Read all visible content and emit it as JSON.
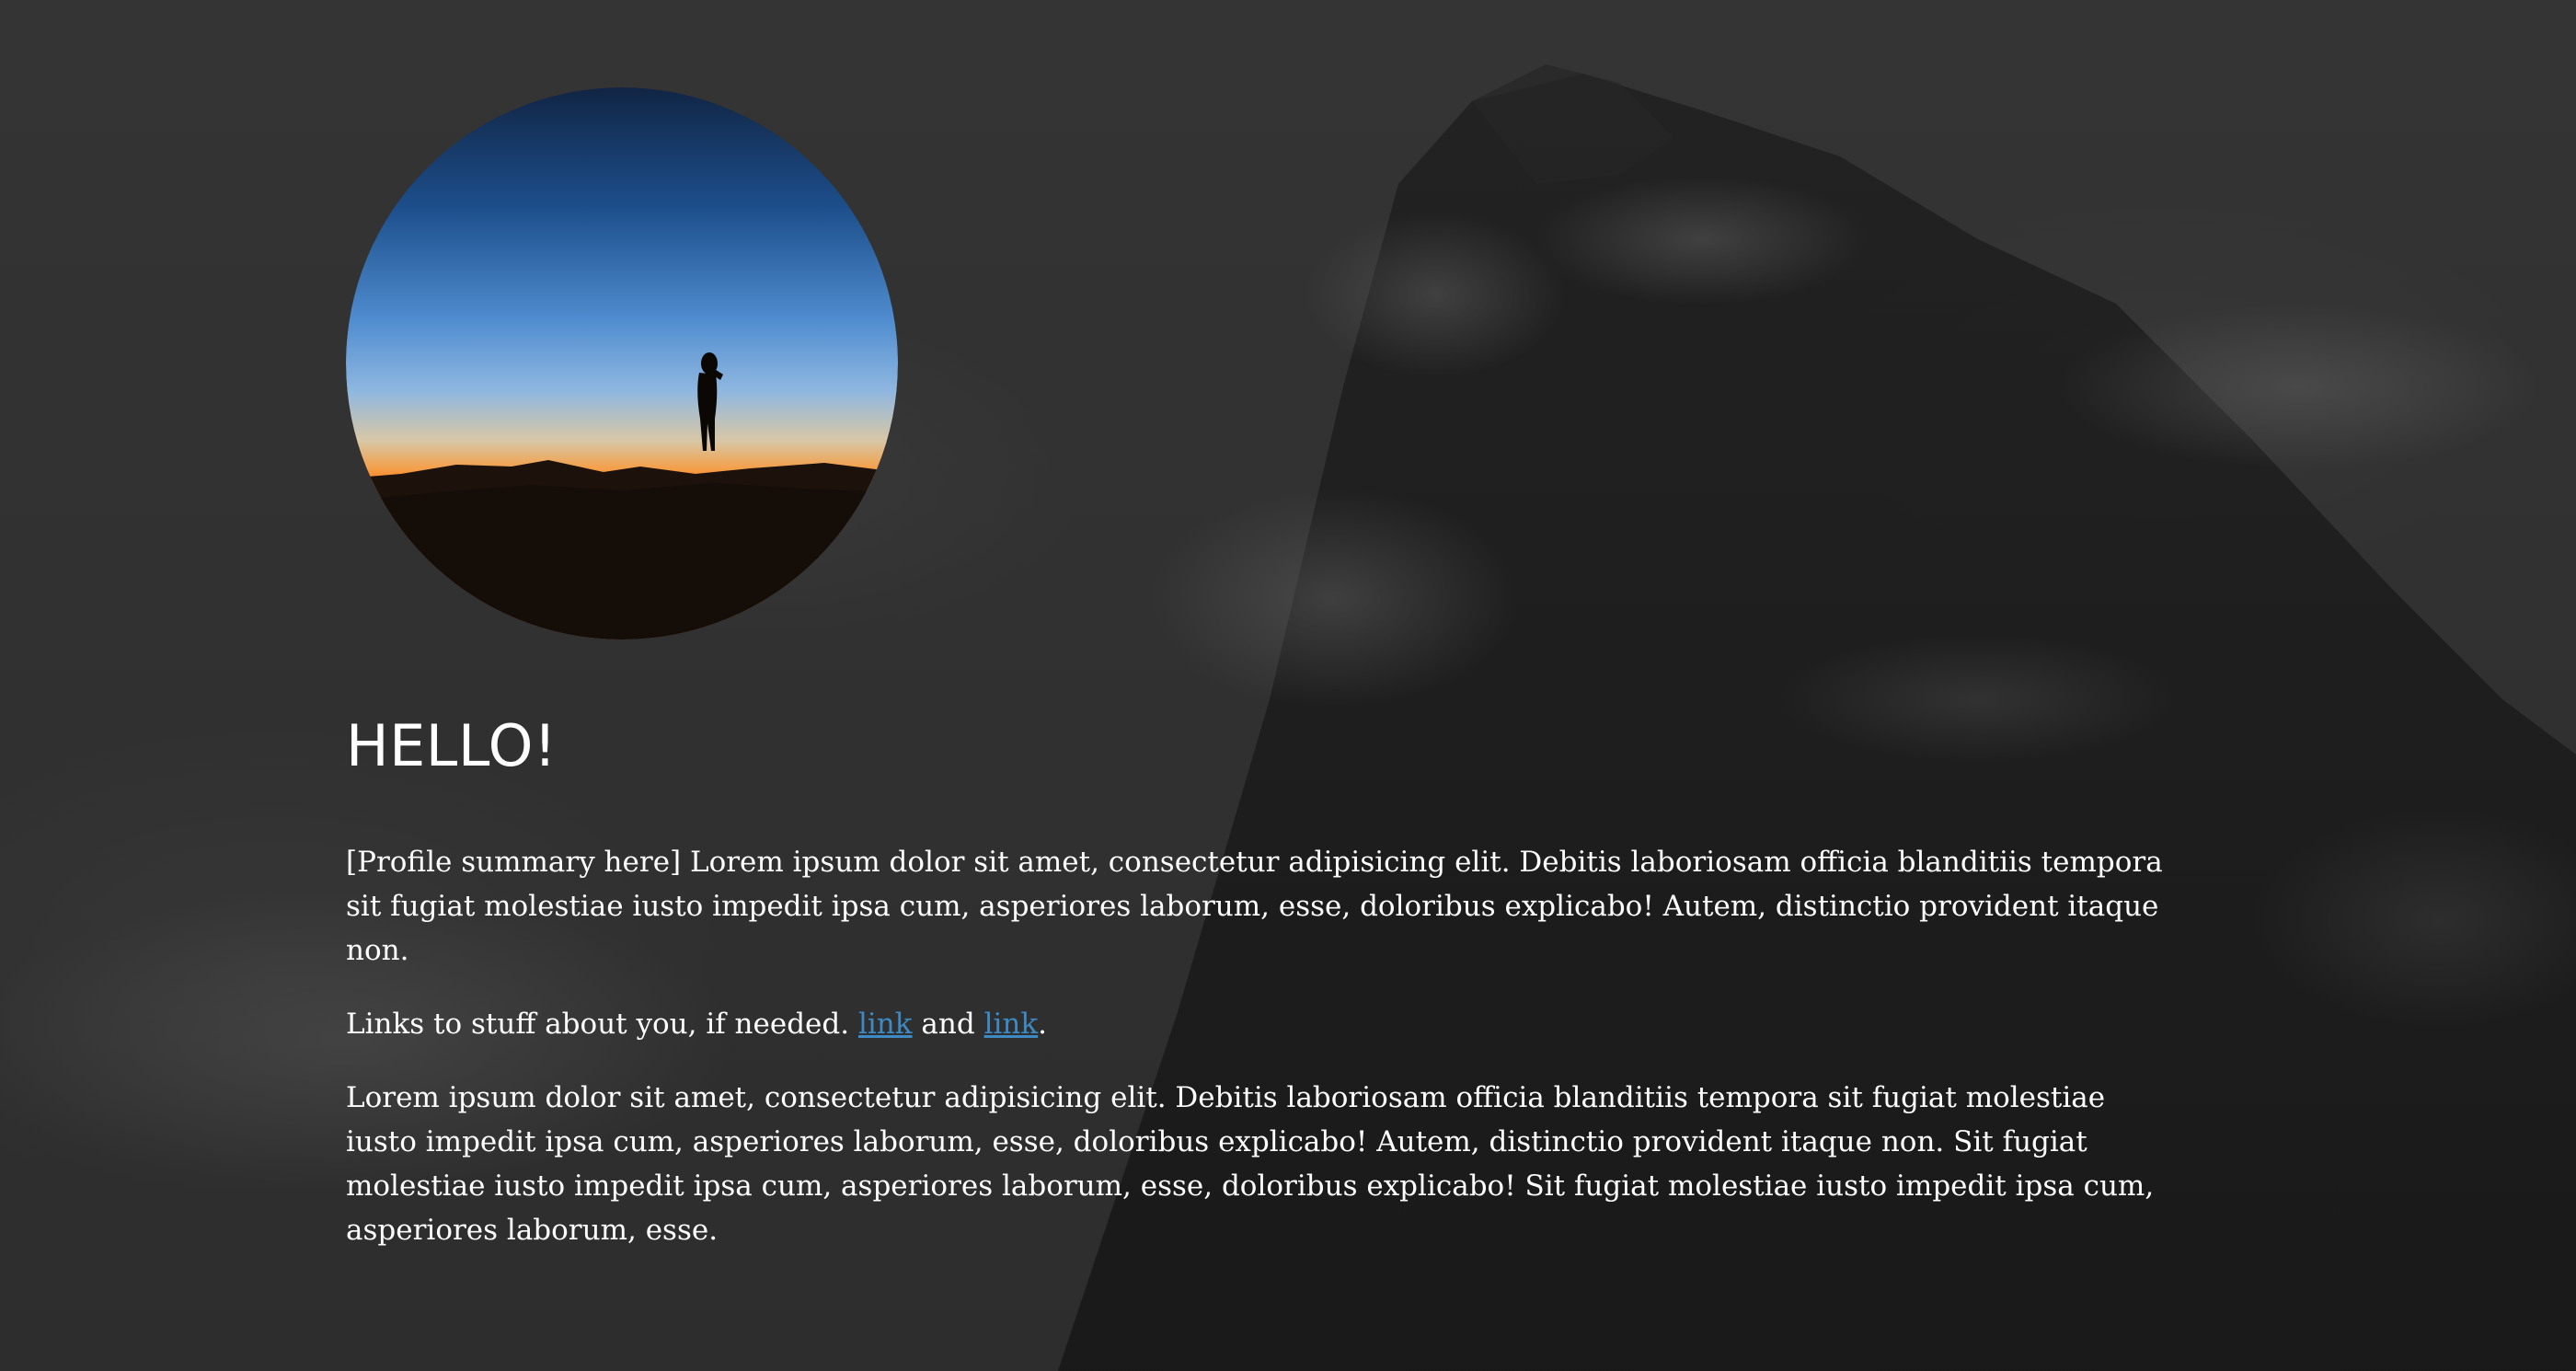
{
  "profile": {
    "avatar_alt": "Silhouette of a person standing on a hill at sunset",
    "greeting": "HELLO!",
    "summary": "[Profile summary here] Lorem ipsum dolor sit amet, consectetur adipisicing elit. Debitis laboriosam officia blanditiis tempora sit fugiat molestiae iusto impedit ipsa cum, asperiores laborum, esse, doloribus explicabo! Autem, distinctio provident itaque non.",
    "links_line": {
      "prefix": "Links to stuff about you, if needed.",
      "link1": "link",
      "middle": "and",
      "link2": "link",
      "suffix": "."
    },
    "body": "Lorem ipsum dolor sit amet, consectetur adipisicing elit. Debitis laboriosam officia blanditiis tempora sit fugiat molestiae iusto impedit ipsa cum, asperiores laborum, esse, doloribus explicabo! Autem, distinctio provident itaque non. Sit fugiat molestiae iusto impedit ipsa cum, asperiores laborum, esse, doloribus explicabo! Sit fugiat molestiae iusto impedit ipsa cum, asperiores laborum, esse."
  },
  "colors": {
    "background": "#333333",
    "text": "#ffffff",
    "link": "#3d8ac4"
  }
}
